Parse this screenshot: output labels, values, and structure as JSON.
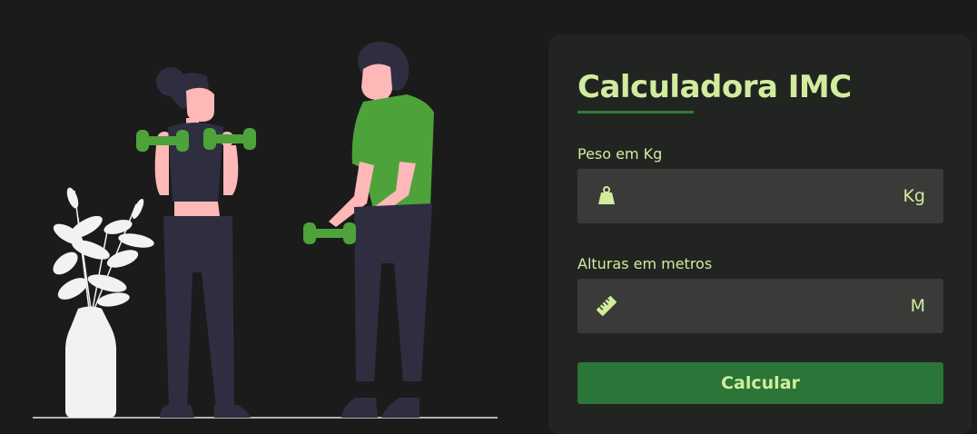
{
  "form": {
    "title": "Calculadora IMC",
    "weight": {
      "label": "Peso em Kg",
      "value": "",
      "unit": "Kg",
      "icon": "weight-icon"
    },
    "height": {
      "label": "Alturas em metros",
      "value": "",
      "unit": "M",
      "icon": "ruler-icon"
    },
    "submit_label": "Calcular"
  },
  "colors": {
    "background": "#1b1b1b",
    "card": "#222421",
    "accent": "#d2ec9e",
    "button": "#2b7538",
    "field": "#3a3b39",
    "illustration_green": "#4ea23a",
    "illustration_dark": "#2f2e41",
    "illustration_skin": "#ffb8b8"
  }
}
